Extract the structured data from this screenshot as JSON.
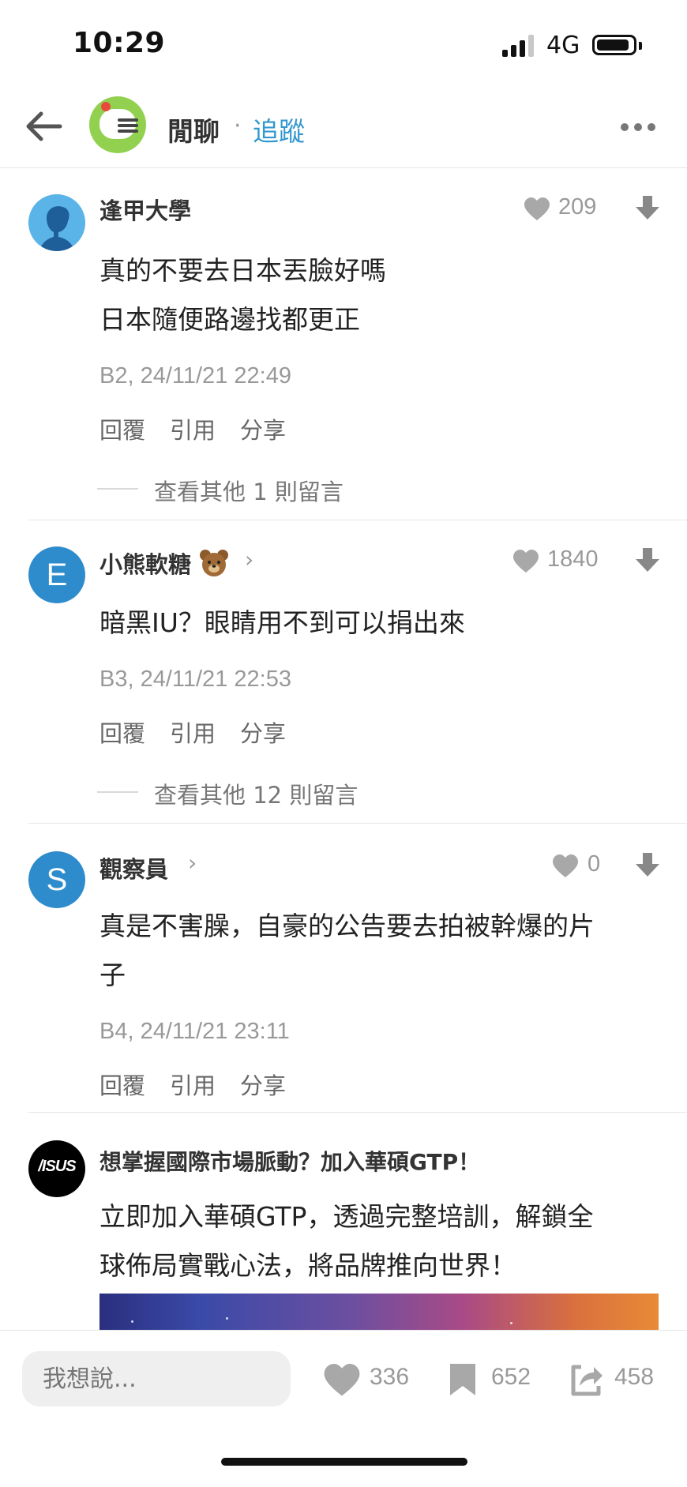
{
  "status_bar": {
    "time": "10:29",
    "network": "4G",
    "battery_level": 0.9
  },
  "header": {
    "board_name": "閒聊",
    "separator": "·",
    "follow_label": "追蹤",
    "icons": [
      "back-arrow-icon",
      "more-icon"
    ]
  },
  "comments": [
    {
      "author": "逢甲大學",
      "likes": "209",
      "body": [
        "真的不要去日本丟臉好嗎",
        "日本隨便路邊找都更正"
      ],
      "meta": "B2, 24/11/21 22:49",
      "actions": [
        "回覆",
        "引用",
        "分享"
      ],
      "view_more": "查看其他 1 則留言"
    },
    {
      "author": "小熊軟糖",
      "avatar_letter": "E",
      "likes": "1840",
      "body": [
        "暗黑IU？眼睛用不到可以捐出來"
      ],
      "meta": "B3, 24/11/21 22:53",
      "actions": [
        "回覆",
        "引用",
        "分享"
      ],
      "view_more": "查看其他 12 則留言"
    },
    {
      "author": "觀察員",
      "avatar_letter": "S",
      "likes": "0",
      "body": [
        "真是不害臊，自豪的公告要去拍被幹爆的片",
        "子"
      ],
      "meta": "B4, 24/11/21 23:11",
      "actions": [
        "回覆",
        "引用",
        "分享"
      ]
    }
  ],
  "ad": {
    "logo_text": "/ISUS",
    "title": "想掌握國際市場脈動？加入華碩GTP！",
    "body": [
      "立即加入華碩GTP，透過完整培訓，解鎖全",
      "球佈局實戰心法，將品牌推向世界！"
    ]
  },
  "bottom_bar": {
    "placeholder": "我想說...",
    "likes": "336",
    "bookmarks": "652",
    "shares": "458"
  },
  "colors": {
    "accent": "#3397cf",
    "board_icon": "#92d050",
    "avatar_blue": "#2e8ccc",
    "muted": "#999999"
  }
}
